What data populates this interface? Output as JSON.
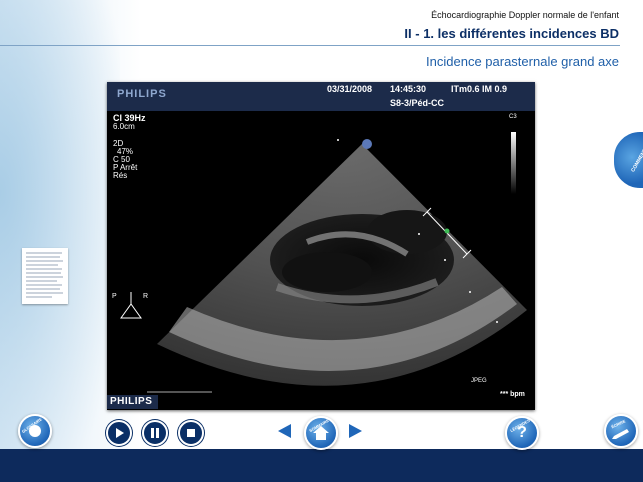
{
  "header": {
    "subtitle": "Échocardiographie Doppler normale de l'enfant",
    "title": "II - 1. les différentes incidences BD",
    "section": "Incidence parasternale grand axe"
  },
  "viewer": {
    "brand": "PHILIPS",
    "date": "03/31/2008",
    "time": "14:45:30",
    "index": "ITm0.6  IM 0.9",
    "probe": "S8-3/Péd-CC",
    "ci": "CI 39Hz",
    "depth": "6.0cm",
    "mode": "2D",
    "gain": "47%",
    "c": "C 50",
    "p": "P Arrêt",
    "res": "Rés",
    "c3": "C3",
    "jpeg": "JPEG",
    "bpm": "*** bpm",
    "orientation_p": "P",
    "orientation_r": "R",
    "brand_bottom": "PHILIPS"
  },
  "buttons": {
    "glossaire": "GLOSSAIRE",
    "sommaire": "SOMMAIRE",
    "legendes": "LÉGENDES",
    "legendes_symbol": "?",
    "ecrire": "ÉCRIRE",
    "commentaires": "COMMENTAIRES"
  },
  "colors": {
    "navy": "#0d2a5c",
    "accent_blue": "#1f66b8",
    "title_blue": "#0c2f66",
    "section_blue": "#1f5fa8"
  }
}
